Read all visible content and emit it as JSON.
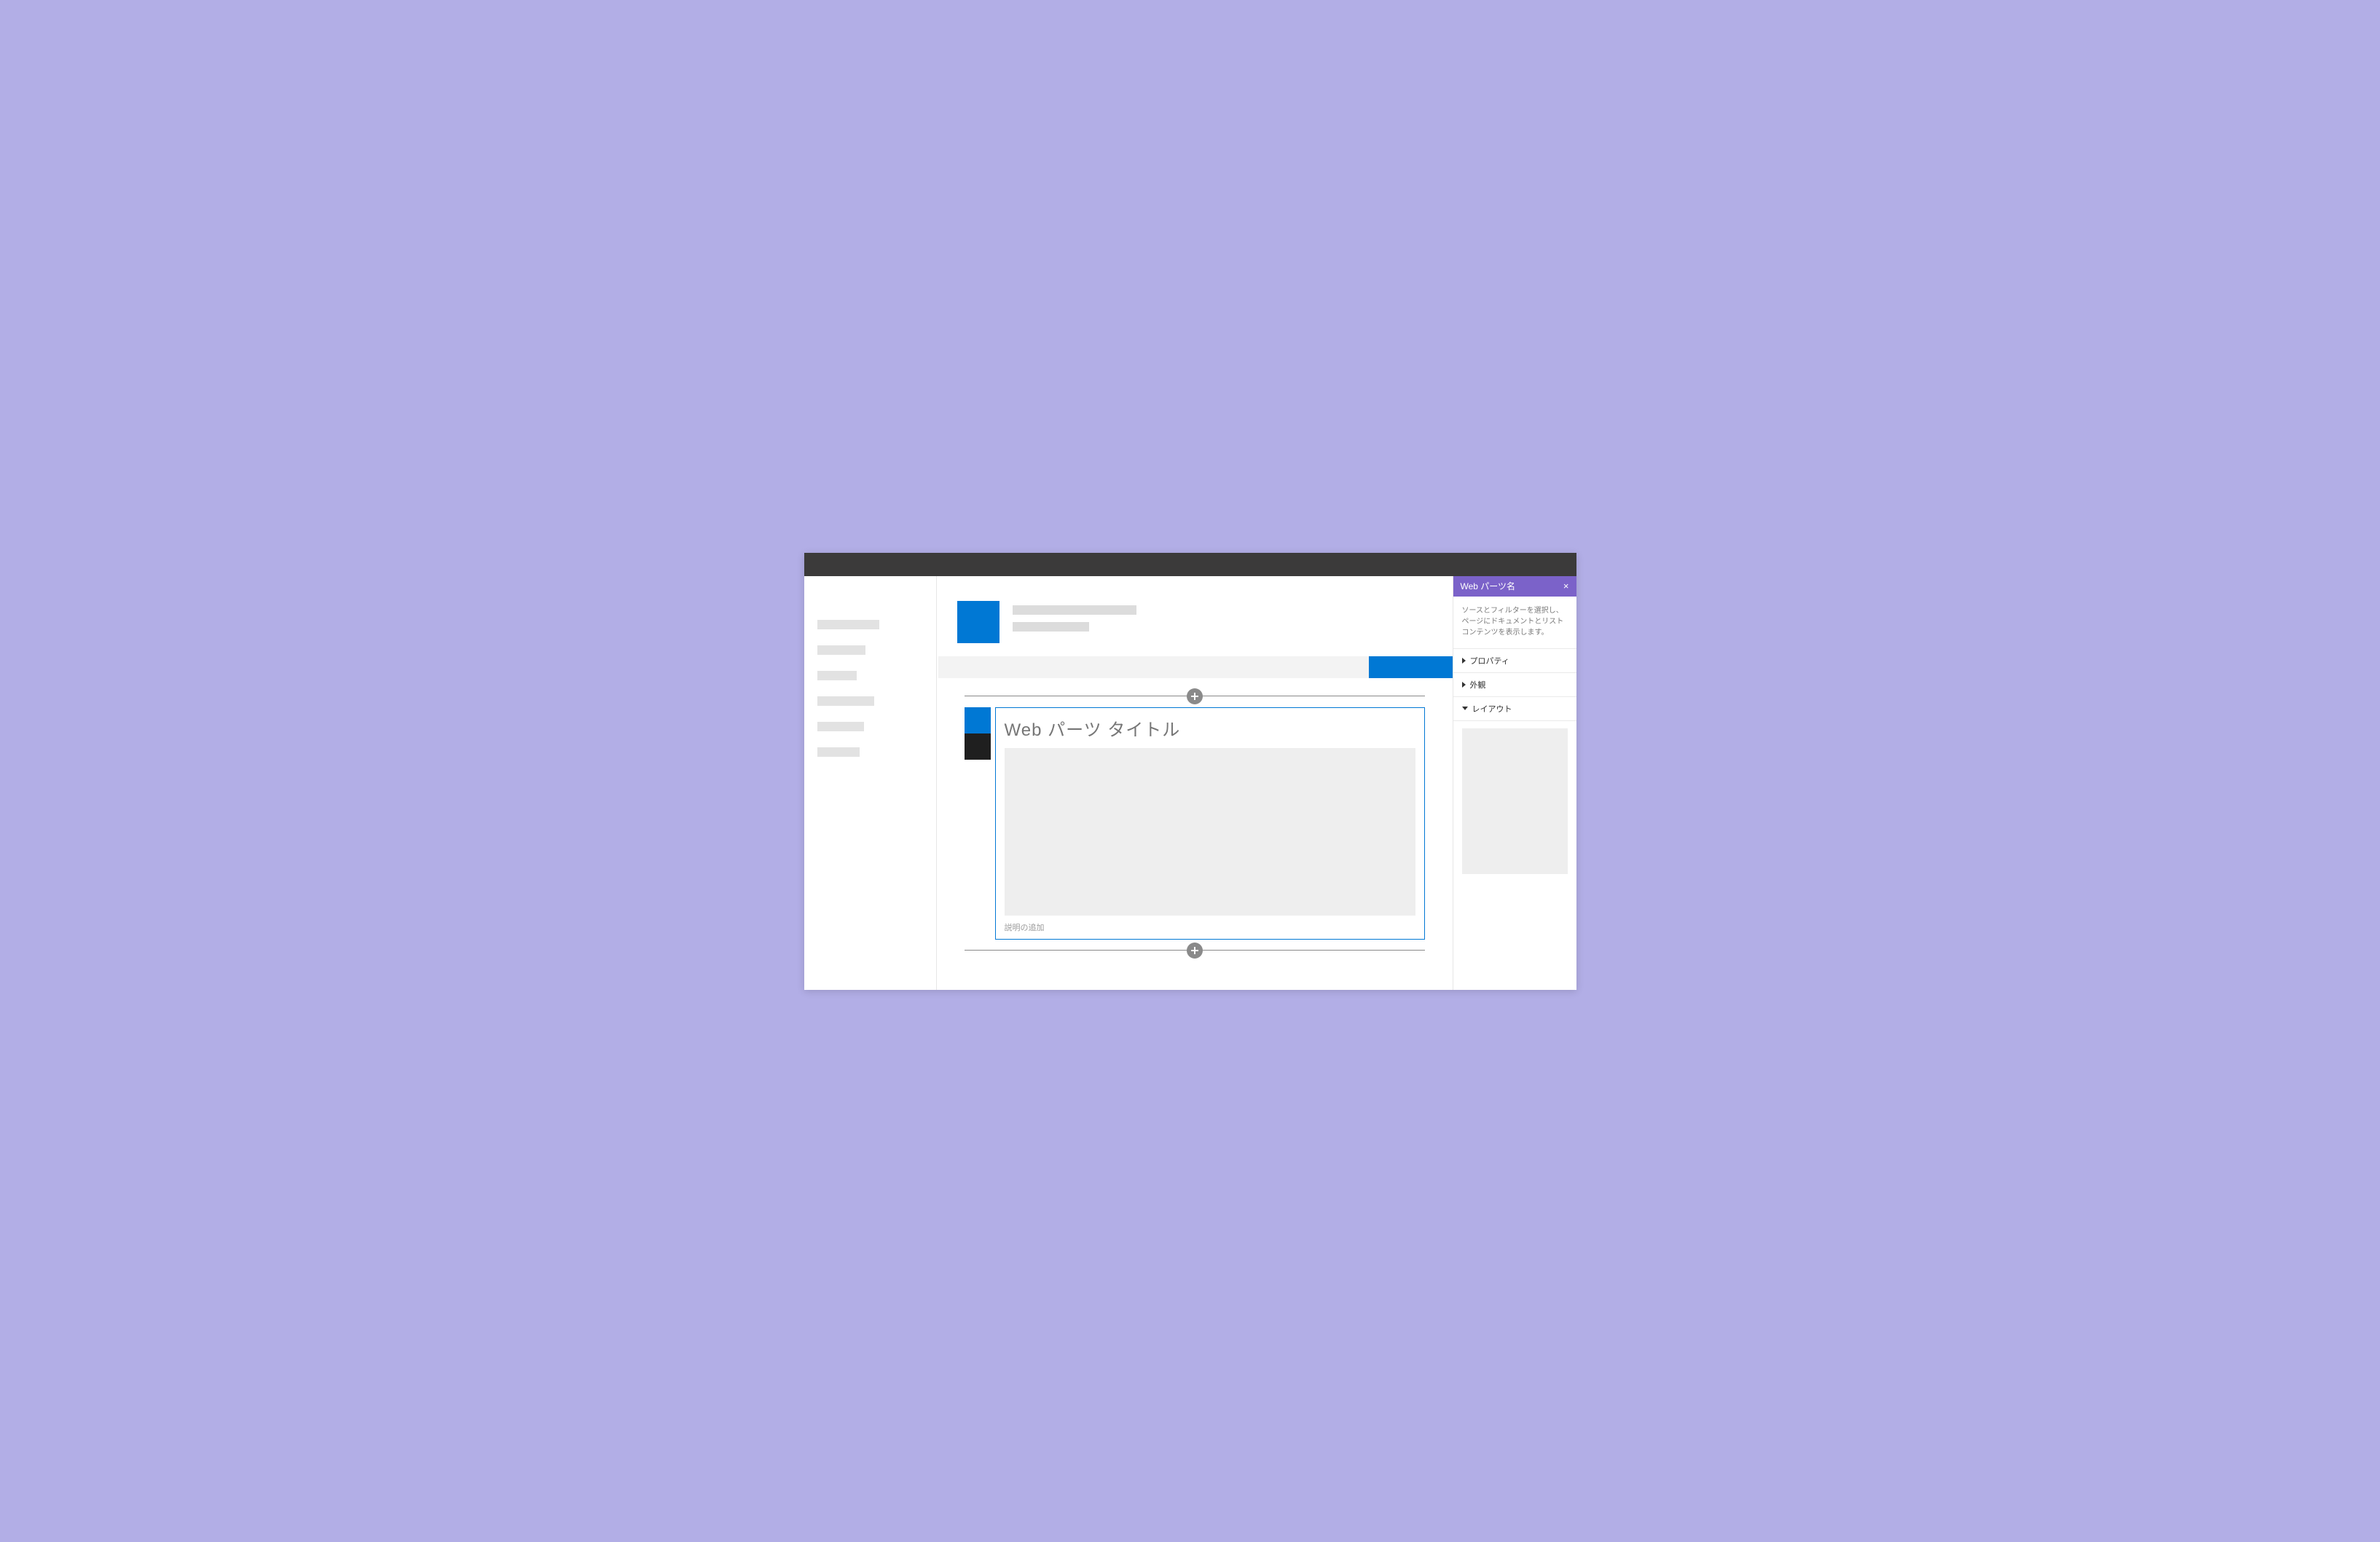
{
  "webpart": {
    "title": "Web パーツ タイトル",
    "add_description": "説明の追加"
  },
  "panel": {
    "title": "Web パーツ名",
    "close": "×",
    "description": "ソースとフィルターを選択し、ページにドキュメントとリスト コンテンツを表示します。",
    "sections": {
      "property": "プロパティ",
      "appearance": "外観",
      "layout": "レイアウト"
    }
  }
}
